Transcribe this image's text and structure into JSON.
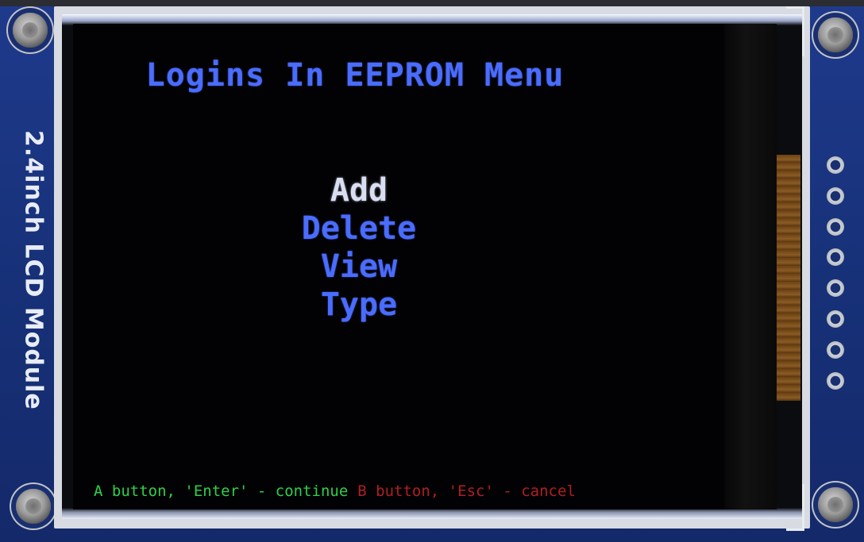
{
  "module": {
    "label": "2.4inch LCD Module"
  },
  "screen": {
    "title": "Logins In EEPROM Menu",
    "menu": {
      "items": [
        {
          "label": "Add",
          "selected": true
        },
        {
          "label": "Delete",
          "selected": false
        },
        {
          "label": "View",
          "selected": false
        },
        {
          "label": "Type",
          "selected": false
        }
      ]
    },
    "footer": {
      "continue_hint": "A button, 'Enter' - continue",
      "cancel_hint": "B button, 'Esc' - cancel"
    }
  },
  "colors": {
    "menu_text": "#4a6cff",
    "selected_text": "#d9def0",
    "continue_hint": "#2ed04a",
    "cancel_hint": "#b01e24",
    "board": "#1f3a8c"
  },
  "icons": [
    "screw-icon",
    "header-pin-icon"
  ]
}
